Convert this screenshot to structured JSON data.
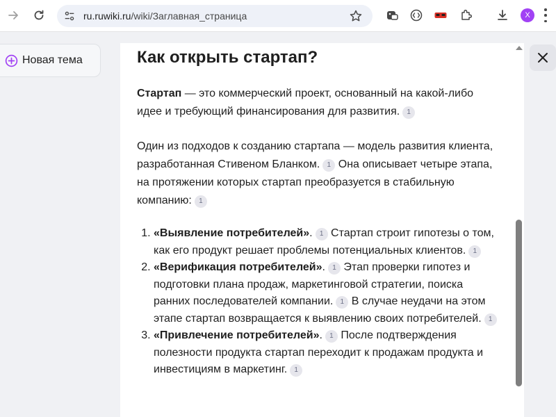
{
  "browser": {
    "url_host": "ru.ruwiki.ru",
    "url_path": "/wiki/Заглавная_страница",
    "profile_initial": "X"
  },
  "sidebar": {
    "new_topic_label": "Новая тема"
  },
  "article": {
    "title": "Как открыть стартап?",
    "ref_label": "1",
    "p1": {
      "bold": "Стартап",
      "text": " — это коммерческий проект, основанный на какой-либо идее и требующий финансирования для развития."
    },
    "p2": {
      "text_a": "Один из подходов к созданию стартапа — модель развития клиента, разработанная Стивеном Бланком.",
      "text_b": " Она описывает четыре этапа, на протяжении которых стартап преобразуется в стабильную компанию:"
    },
    "stages": [
      {
        "title": "«Выявление потребителей»",
        "text_a": " Стартап строит гипотезы о том, как его продукт решает проблемы потенциальных клиентов."
      },
      {
        "title": "«Верификация потребителей»",
        "text_a": " Этап проверки гипотез и подготовки плана продаж, маркетинговой стратегии, поиска ранних последователей компании.",
        "text_b": " В случае неудачи на этом этапе стартап возвращается к выявлению своих потребителей."
      },
      {
        "title": "«Привлечение потребителей»",
        "text_a": " После подтверждения полезности продукта стартап переходит к продажам продукта и инвестициям в маркетинг."
      }
    ]
  },
  "colors": {
    "accent_purple": "#a142f4",
    "ref_badge": "#e6e6ec"
  }
}
